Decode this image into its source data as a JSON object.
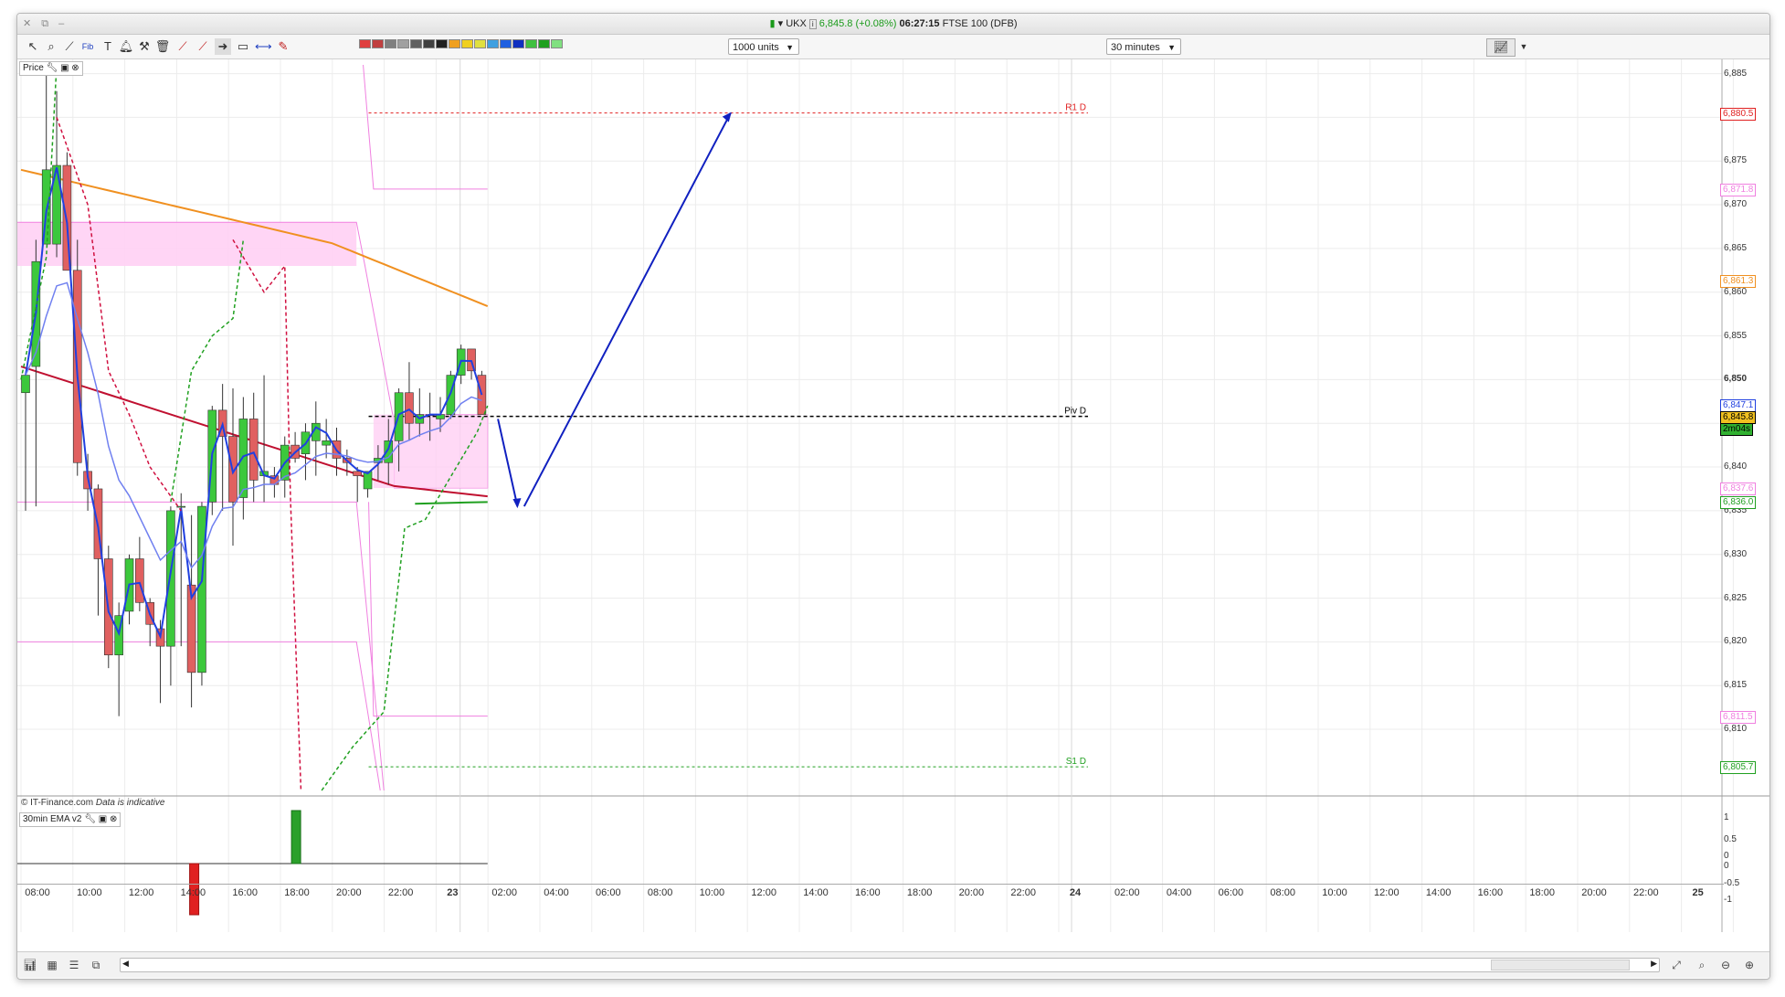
{
  "window": {
    "controls": "✕ ⧉ –"
  },
  "title": {
    "symbol": "UKX",
    "price": "6,845.8",
    "change": "(+0.08%)",
    "time": "06:27:15",
    "instrument": "FTSE 100 (DFB)"
  },
  "toolbar": {
    "icons": [
      "cursor-icon",
      "zoom-icon",
      "trend-icon",
      "fib-icon",
      "text-icon",
      "alert-icon",
      "tools-icon",
      "trash-icon",
      "line-icon",
      "line-icon",
      "arrow-icon",
      "shape-icon",
      "hline-icon",
      "pencil-icon"
    ],
    "swatch_colors": [
      "#e04040",
      "#c04040",
      "#808080",
      "#a0a0a0",
      "#606060",
      "#404040",
      "#202020",
      "#f0a020",
      "#f0d020",
      "#e0e040",
      "#40a0e0",
      "#2060e0",
      "#1030c0",
      "#40c040",
      "#20a020",
      "#80e080"
    ],
    "units_label": "1000 units",
    "interval_label": "30 minutes"
  },
  "panels": {
    "price_label": "Price",
    "ema_label": "30min EMA v2"
  },
  "watermark": {
    "source": "© IT-Finance.com",
    "note": "Data is indicative"
  },
  "levels": {
    "r1": "R1 D",
    "piv": "Piv D",
    "s1": "S1 D"
  },
  "yaxis": {
    "ticks": [
      "6,885",
      "6,880",
      "6,875",
      "6,870",
      "6,865",
      "6,860",
      "6,855",
      "6,850",
      "6,845",
      "6,840",
      "6,835",
      "6,830",
      "6,825",
      "6,820",
      "6,815",
      "6,810"
    ],
    "boxes": [
      {
        "text": "6,880.5",
        "color": "#e02020"
      },
      {
        "text": "6,871.8",
        "color": "#f080e0"
      },
      {
        "text": "6,861.3",
        "color": "#f09020"
      },
      {
        "text": "6,847.1",
        "color": "#2040e0"
      },
      {
        "text": "6,845.8",
        "color": "#000000"
      },
      {
        "text": "2m04s",
        "color": "#000000"
      },
      {
        "text": "6,837.6",
        "color": "#f080e0"
      },
      {
        "text": "6,836.0",
        "color": "#20a020"
      },
      {
        "text": "6,811.5",
        "color": "#f080e0"
      },
      {
        "text": "6,805.7",
        "color": "#20a020"
      }
    ],
    "ema_ticks": [
      "1",
      "0.5",
      "0",
      "0",
      "-0.5",
      "-1"
    ]
  },
  "xaxis": {
    "labels": [
      "08:00",
      "10:00",
      "12:00",
      "14:00",
      "16:00",
      "18:00",
      "20:00",
      "22:00",
      "23",
      "02:00",
      "04:00",
      "06:00",
      "08:00",
      "10:00",
      "12:00",
      "14:00",
      "16:00",
      "18:00",
      "20:00",
      "22:00",
      "24",
      "02:00",
      "04:00",
      "06:00",
      "08:00",
      "10:00",
      "12:00",
      "14:00",
      "16:00",
      "18:00",
      "20:00",
      "22:00",
      "25"
    ]
  },
  "chart_data": {
    "type": "candlestick",
    "ylim": [
      6803,
      6886
    ],
    "candles": [
      {
        "o": 6848.5,
        "h": 6850.5,
        "l": 6835,
        "c": 6850.5
      },
      {
        "o": 6851.5,
        "h": 6866,
        "l": 6835.5,
        "c": 6863.5
      },
      {
        "o": 6865.5,
        "h": 6885.5,
        "l": 6866,
        "c": 6874
      },
      {
        "o": 6865.5,
        "h": 6883,
        "l": 6864,
        "c": 6874.5
      },
      {
        "o": 6874.5,
        "h": 6876,
        "l": 6863,
        "c": 6862.5
      },
      {
        "o": 6862.5,
        "h": 6866,
        "l": 6839,
        "c": 6840.5
      },
      {
        "o": 6839.5,
        "h": 6841.5,
        "l": 6835,
        "c": 6837.5
      },
      {
        "o": 6837.5,
        "h": 6838,
        "l": 6823,
        "c": 6829.5
      },
      {
        "o": 6829.5,
        "h": 6831,
        "l": 6817,
        "c": 6818.5
      },
      {
        "o": 6818.5,
        "h": 6824.5,
        "l": 6811.5,
        "c": 6823
      },
      {
        "o": 6823.5,
        "h": 6830,
        "l": 6822,
        "c": 6829.5
      },
      {
        "o": 6829.5,
        "h": 6832,
        "l": 6823.5,
        "c": 6824.5
      },
      {
        "o": 6824.5,
        "h": 6825,
        "l": 6819.5,
        "c": 6822
      },
      {
        "o": 6821.5,
        "h": 6822.5,
        "l": 6813,
        "c": 6819.5
      },
      {
        "o": 6819.5,
        "h": 6835.5,
        "l": 6815,
        "c": 6835
      },
      {
        "o": 6835.5,
        "h": 6837,
        "l": 6819.5,
        "c": 6835.5
      },
      {
        "o": 6826.5,
        "h": 6834.5,
        "l": 6812.5,
        "c": 6816.5
      },
      {
        "o": 6816.5,
        "h": 6836,
        "l": 6815,
        "c": 6835.5
      },
      {
        "o": 6836,
        "h": 6847,
        "l": 6834.5,
        "c": 6846.5
      },
      {
        "o": 6846.5,
        "h": 6849.5,
        "l": 6835,
        "c": 6843.5
      },
      {
        "o": 6843.5,
        "h": 6849,
        "l": 6831,
        "c": 6836
      },
      {
        "o": 6836.5,
        "h": 6848,
        "l": 6834,
        "c": 6845.5
      },
      {
        "o": 6845.5,
        "h": 6848.5,
        "l": 6836,
        "c": 6838.5
      },
      {
        "o": 6839,
        "h": 6850.5,
        "l": 6836,
        "c": 6839.5
      },
      {
        "o": 6839,
        "h": 6840,
        "l": 6836.5,
        "c": 6838
      },
      {
        "o": 6838.5,
        "h": 6843.5,
        "l": 6836.5,
        "c": 6842.5
      },
      {
        "o": 6842.5,
        "h": 6844,
        "l": 6840.5,
        "c": 6841
      },
      {
        "o": 6841.5,
        "h": 6845,
        "l": 6838.5,
        "c": 6844
      },
      {
        "o": 6843,
        "h": 6847.5,
        "l": 6839,
        "c": 6845
      },
      {
        "o": 6842.5,
        "h": 6845.5,
        "l": 6841,
        "c": 6843
      },
      {
        "o": 6843,
        "h": 6844.5,
        "l": 6839,
        "c": 6841
      },
      {
        "o": 6841,
        "h": 6842,
        "l": 6839,
        "c": 6840.5
      },
      {
        "o": 6839.5,
        "h": 6840,
        "l": 6836,
        "c": 6839
      },
      {
        "o": 6837.5,
        "h": 6839.5,
        "l": 6836.5,
        "c": 6839.5
      },
      {
        "o": 6840.5,
        "h": 6842.5,
        "l": 6838.5,
        "c": 6841
      },
      {
        "o": 6840.5,
        "h": 6845.5,
        "l": 6838,
        "c": 6843
      },
      {
        "o": 6843,
        "h": 6849,
        "l": 6839.5,
        "c": 6848.5
      },
      {
        "o": 6848.5,
        "h": 6852,
        "l": 6843,
        "c": 6845
      },
      {
        "o": 6845,
        "h": 6849,
        "l": 6843.5,
        "c": 6846
      },
      {
        "o": 6846,
        "h": 6848.5,
        "l": 6843,
        "c": 6846
      },
      {
        "o": 6845.5,
        "h": 6848,
        "l": 6844,
        "c": 6846
      },
      {
        "o": 6846,
        "h": 6851,
        "l": 6845.5,
        "c": 6850.5
      },
      {
        "o": 6850.5,
        "h": 6854,
        "l": 6849.5,
        "c": 6853.5
      },
      {
        "o": 6853.5,
        "h": 6853.5,
        "l": 6850,
        "c": 6851
      },
      {
        "o": 6850.5,
        "h": 6851,
        "l": 6846,
        "c": 6846
      }
    ],
    "levels": {
      "r1": 6880.5,
      "r_pink": 6871.8,
      "piv": 6845.8,
      "s_pink": 6811.5,
      "s1": 6805.7
    },
    "ema_hist": [
      {
        "bar": 26,
        "value": 1
      },
      {
        "bar": 12,
        "value": -1
      }
    ]
  }
}
